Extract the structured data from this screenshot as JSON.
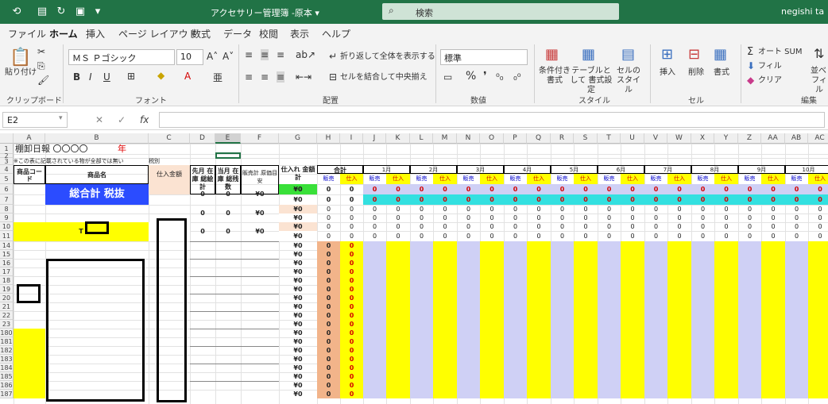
{
  "titlebar": {
    "doc_title": "アクセサリー管理簿 -原本 ▾",
    "search_label": "検索",
    "user": "negishi ta"
  },
  "menu": [
    "ファイル",
    "ホーム",
    "挿入",
    "ページ レイアウト",
    "数式",
    "データ",
    "校閲",
    "表示",
    "ヘルプ"
  ],
  "ribbon": {
    "paste": "貼り付け",
    "font_name": "ＭＳ Ｐゴシック",
    "font_size": "10",
    "wrap_text": "折り返して全体を表示する",
    "merge_center": "セルを結合して中央揃え",
    "number_format": "標準",
    "cond_format": "条件付き 書式",
    "table_format": "テーブルとして 書式設定",
    "cell_style": "セルの スタイル",
    "insert": "挿入",
    "delete": "削除",
    "format": "書式",
    "autosum": "オート SUM",
    "fill": "フィル",
    "clear": "クリア",
    "sort": "並べ",
    "filter": "フィル",
    "groups": [
      "クリップボード",
      "フォント",
      "配置",
      "数値",
      "スタイル",
      "セル",
      "編集"
    ]
  },
  "formula_bar": {
    "name_box": "E2",
    "fx": "fx"
  },
  "sheet": {
    "columns": [
      "A",
      "B",
      "C",
      "D",
      "E",
      "F",
      "G",
      "H",
      "I",
      "J",
      "K",
      "L",
      "M",
      "N",
      "O",
      "P",
      "Q",
      "R",
      "S",
      "T",
      "U",
      "V",
      "W",
      "X",
      "Y",
      "Z",
      "AA",
      "AB",
      "AC"
    ],
    "row_numbers": [
      "1",
      "2",
      "3",
      "4",
      "5",
      "6",
      "7",
      "8",
      "9",
      "10",
      "11",
      "14",
      "15",
      "16",
      "17",
      "18",
      "19",
      "20",
      "21",
      "22",
      "23",
      "180",
      "181",
      "182",
      "183",
      "184",
      "185",
      "186",
      "187"
    ],
    "title": "棚卸日報 〇〇〇〇",
    "title_year": "年",
    "note": "※この表に記載されている物が全部では無い",
    "tax": "税別",
    "hdr_code": "商品コード",
    "hdr_name": "商品名",
    "hdr_purchase": "仕入金額",
    "hdr_prev": "先月 在庫 総絵計",
    "hdr_curr": "当月 在庫 総残数",
    "hdr_sales_cost": "販売計 原価目安",
    "hdr_purchase_total": "仕入れ 金額計",
    "purchase_total_value": "¥0",
    "hdr_total": "合計",
    "months": [
      "1月",
      "2月",
      "3月",
      "4月",
      "5月",
      "6月",
      "7月",
      "8月",
      "9月",
      "10月"
    ],
    "sales": "販売",
    "stock": "仕入",
    "grand_total": "総合計 税抜",
    "t_label": "T",
    "zero": "0",
    "yen_zero": "¥0",
    "yen_zero_full": "¥0"
  },
  "colors": {
    "excel_green": "#217346",
    "blue": "#2b4cff",
    "yellow": "#ffff00",
    "cyan": "#33e0e0",
    "lavender": "#cfd0f5",
    "peach": "#fbe3d2",
    "green_cell": "#39e039"
  }
}
